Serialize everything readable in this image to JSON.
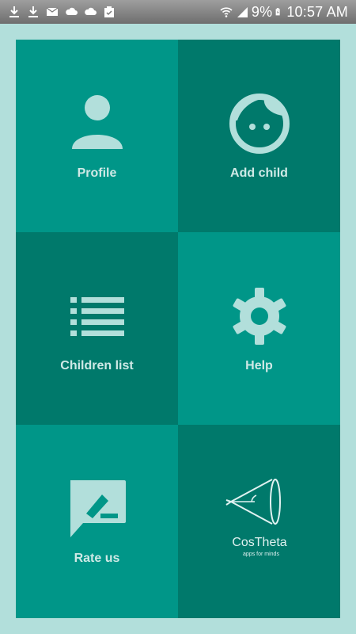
{
  "status_bar": {
    "icons": [
      "download-icon",
      "download-icon",
      "mail-icon",
      "cloud-icon",
      "cloud-icon",
      "clipboard-icon"
    ],
    "battery_percent": "9%",
    "time": "10:57 AM"
  },
  "menu": {
    "tiles": [
      {
        "label": "Profile",
        "icon": "person-icon"
      },
      {
        "label": "Add child",
        "icon": "child-face-icon"
      },
      {
        "label": "Children list",
        "icon": "list-icon"
      },
      {
        "label": "Help",
        "icon": "gear-icon"
      },
      {
        "label": "Rate us",
        "icon": "feedback-edit-icon"
      },
      {
        "label": "",
        "icon": "costheta-logo"
      }
    ]
  },
  "brand": {
    "name": "CosTheta",
    "tagline": "apps for minds"
  },
  "colors": {
    "background": "#b2dfdb",
    "tile_light": "#009688",
    "tile_dark": "#00796b",
    "icon": "#b2dfdb",
    "label": "#cfe9e6"
  }
}
